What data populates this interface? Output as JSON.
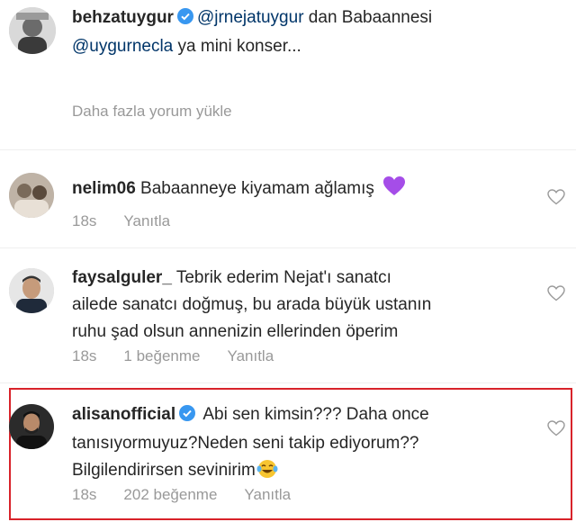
{
  "caption": {
    "username": "behzatuygur",
    "mention1": "@jrnejatuygur",
    "text1": " dan Babaannesi",
    "mention2": "@uygurnecla",
    "text2": " ya mini konser..."
  },
  "load_more": "Daha fazla yorum yükle",
  "comments": [
    {
      "username": "nelim06",
      "text": "Babaanneye kiyamam ağlamış",
      "emoji": "purple-heart",
      "time": "18s",
      "reply": "Yanıtla"
    },
    {
      "username": "faysalguler_",
      "line1": "Tebrik ederim Nejat'ı sanatcı",
      "line2": "ailede sanatcı doğmuş, bu arada büyük ustanın",
      "line3": "ruhu şad olsun annenizin ellerinden öperim",
      "time": "18s",
      "likes": "1 beğenme",
      "reply": "Yanıtla"
    },
    {
      "username": "alisanofficial",
      "line1": "Abi sen kimsin??? Daha once",
      "line2": "tanısıyormuyuz?Neden seni takip ediyorum??",
      "line3": "Bilgilendirirsen sevinirim",
      "emoji": "tears-of-joy",
      "time": "18s",
      "likes": "202 beğenme",
      "reply": "Yanıtla"
    }
  ],
  "colors": {
    "verified": "#3897f0",
    "highlight": "#d8232a",
    "meta": "#999999"
  }
}
